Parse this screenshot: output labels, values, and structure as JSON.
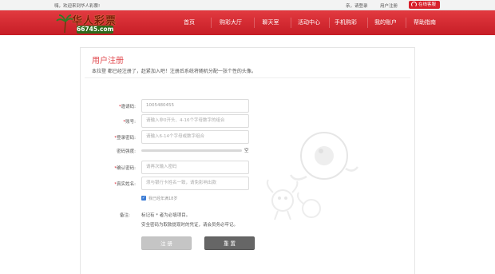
{
  "topbar": {
    "welcome": "嗨，欢迎来到华人彩票!",
    "login": "亲，请登录",
    "help": "用户注册",
    "service": "在线客服"
  },
  "logo": {
    "name": "华人彩票",
    "domain": "66745.com"
  },
  "nav": [
    "首页",
    "购彩大厅",
    "聊天室",
    "活动中心",
    "手机购彩",
    "我的账户",
    "帮助指南"
  ],
  "page": {
    "title": "用户注册",
    "intro": "本拉登 都已经注册了，赶紧加入吧！注册后系统将随机分配一张个性的头像。"
  },
  "form": {
    "invite": {
      "label": "邀请码",
      "value": "1005480455"
    },
    "account": {
      "label": "账号",
      "placeholder": "请输入非0开头、4-16个字母数字的组合"
    },
    "password": {
      "label": "登录密码",
      "placeholder": "请输入6-14个字母或数字组合"
    },
    "strength": {
      "label": "密码强度",
      "value": "空",
      "level": 0
    },
    "confirm": {
      "label": "确认密码",
      "placeholder": "请再次输入密码"
    },
    "realname": {
      "label": "真实姓名",
      "placeholder": "须与银行卡姓名一致，请免影响出款"
    },
    "agree": {
      "label": "我已经年满18岁",
      "checked": true
    },
    "note_label": "备注:",
    "note1": "标记有 * 者为必填项目。",
    "note2": "安全密码为取款提现时的凭证，请会员务必牢记。",
    "submit": "注 册",
    "reset": "重 置"
  },
  "colors": {
    "brand_red": "#d7202b",
    "title_red": "#e14a4f"
  }
}
